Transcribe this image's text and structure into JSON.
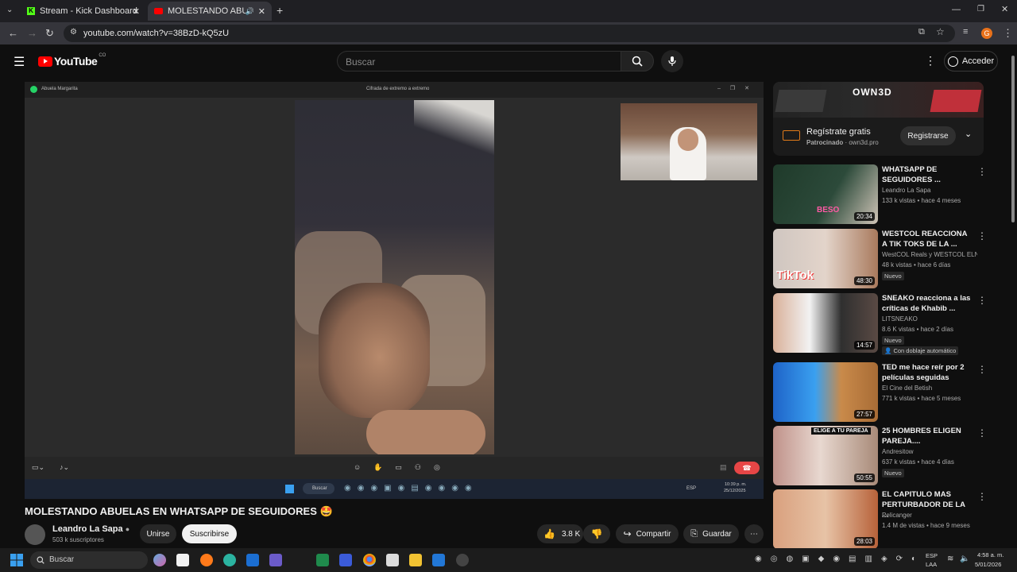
{
  "browser": {
    "tabs": [
      {
        "title": "Stream - Kick Dashboard"
      },
      {
        "title": "MOLESTANDO ABUELAS EN"
      }
    ],
    "url": "youtube.com/watch?v=38BzD-kQ5zU",
    "profile_initial": "G"
  },
  "yt": {
    "logo": "YouTube",
    "country": "CO",
    "search_placeholder": "Buscar",
    "signin": "Acceder"
  },
  "player": {
    "contact": "Abuela Margarita",
    "encryption": "Cifrada de extremo a extremo",
    "inner_search": "Buscar",
    "inner_lang": "ESP",
    "inner_time": "10:39 p. m.",
    "inner_date": "25/12/2025"
  },
  "video": {
    "title": "MOLESTANDO ABUELAS EN WHATSAPP DE SEGUIDORES 🤩",
    "channel": "Leandro La Sapa",
    "subscribers": "503 k suscriptores",
    "join": "Unirse",
    "subscribe": "Suscribirse",
    "likes": "3.8 K",
    "share": "Compartir",
    "save": "Guardar"
  },
  "ad": {
    "title": "Regístrate gratis",
    "sponsored": "Patrocinado",
    "domain": "own3d.pro",
    "cta": "Registrarse",
    "brand": "OWN3D"
  },
  "recommendations": [
    {
      "title": "WHATSAPP DE SEGUIDORES ...",
      "channel": "Leandro La Sapa",
      "meta": "133 k vistas • hace 4 meses",
      "duration": "20:34",
      "badge": "",
      "extra": "",
      "thumb_text": "BESO"
    },
    {
      "title": "WESTCOL REACCIONA A TIK TOKS DE LA ...",
      "channel": "WestCOL Reals y WESTCOL ELNE...",
      "meta": "48 k vistas • hace 6 días",
      "duration": "48:30",
      "badge": "Nuevo",
      "extra": "",
      "thumb_text": "TikTok"
    },
    {
      "title": "SNEAKO reacciona a las críticas de Khabib ...",
      "channel": "LITSNEAKO",
      "meta": "8.6 K vistas • hace 2 días",
      "duration": "14:57",
      "badge": "Nuevo",
      "extra": "Con doblaje automático",
      "thumb_text": ""
    },
    {
      "title": "TED me hace reír por 2 películas seguidas",
      "channel": "El Cine del Betish",
      "meta": "771 k vistas • hace 5 meses",
      "duration": "27:57",
      "badge": "",
      "extra": "",
      "thumb_text": ""
    },
    {
      "title": "25 HOMBRES ELIGEN PAREJA....",
      "channel": "Andresitow",
      "meta": "637 k vistas • hace 4 días",
      "duration": "50:55",
      "badge": "Nuevo",
      "extra": "",
      "thumb_text": "ELIGE A TU PAREJA"
    },
    {
      "title": "EL CAPITULO MAS PERTURBADOR DE LA ...",
      "channel": "Pelicanger",
      "meta": "1.4 M de vistas • hace 9 meses",
      "duration": "28:03",
      "badge": "",
      "extra": "",
      "thumb_text": ""
    }
  ],
  "taskbar": {
    "search": "Buscar",
    "lang": "ESP",
    "lang2": "LAA",
    "time": "4:58 a. m.",
    "date": "5/01/2026"
  },
  "colors": {
    "background": "#0f0f0f",
    "youtube_red": "#ff0000",
    "end_call": "#e74646",
    "whatsapp_green": "#25d366"
  }
}
